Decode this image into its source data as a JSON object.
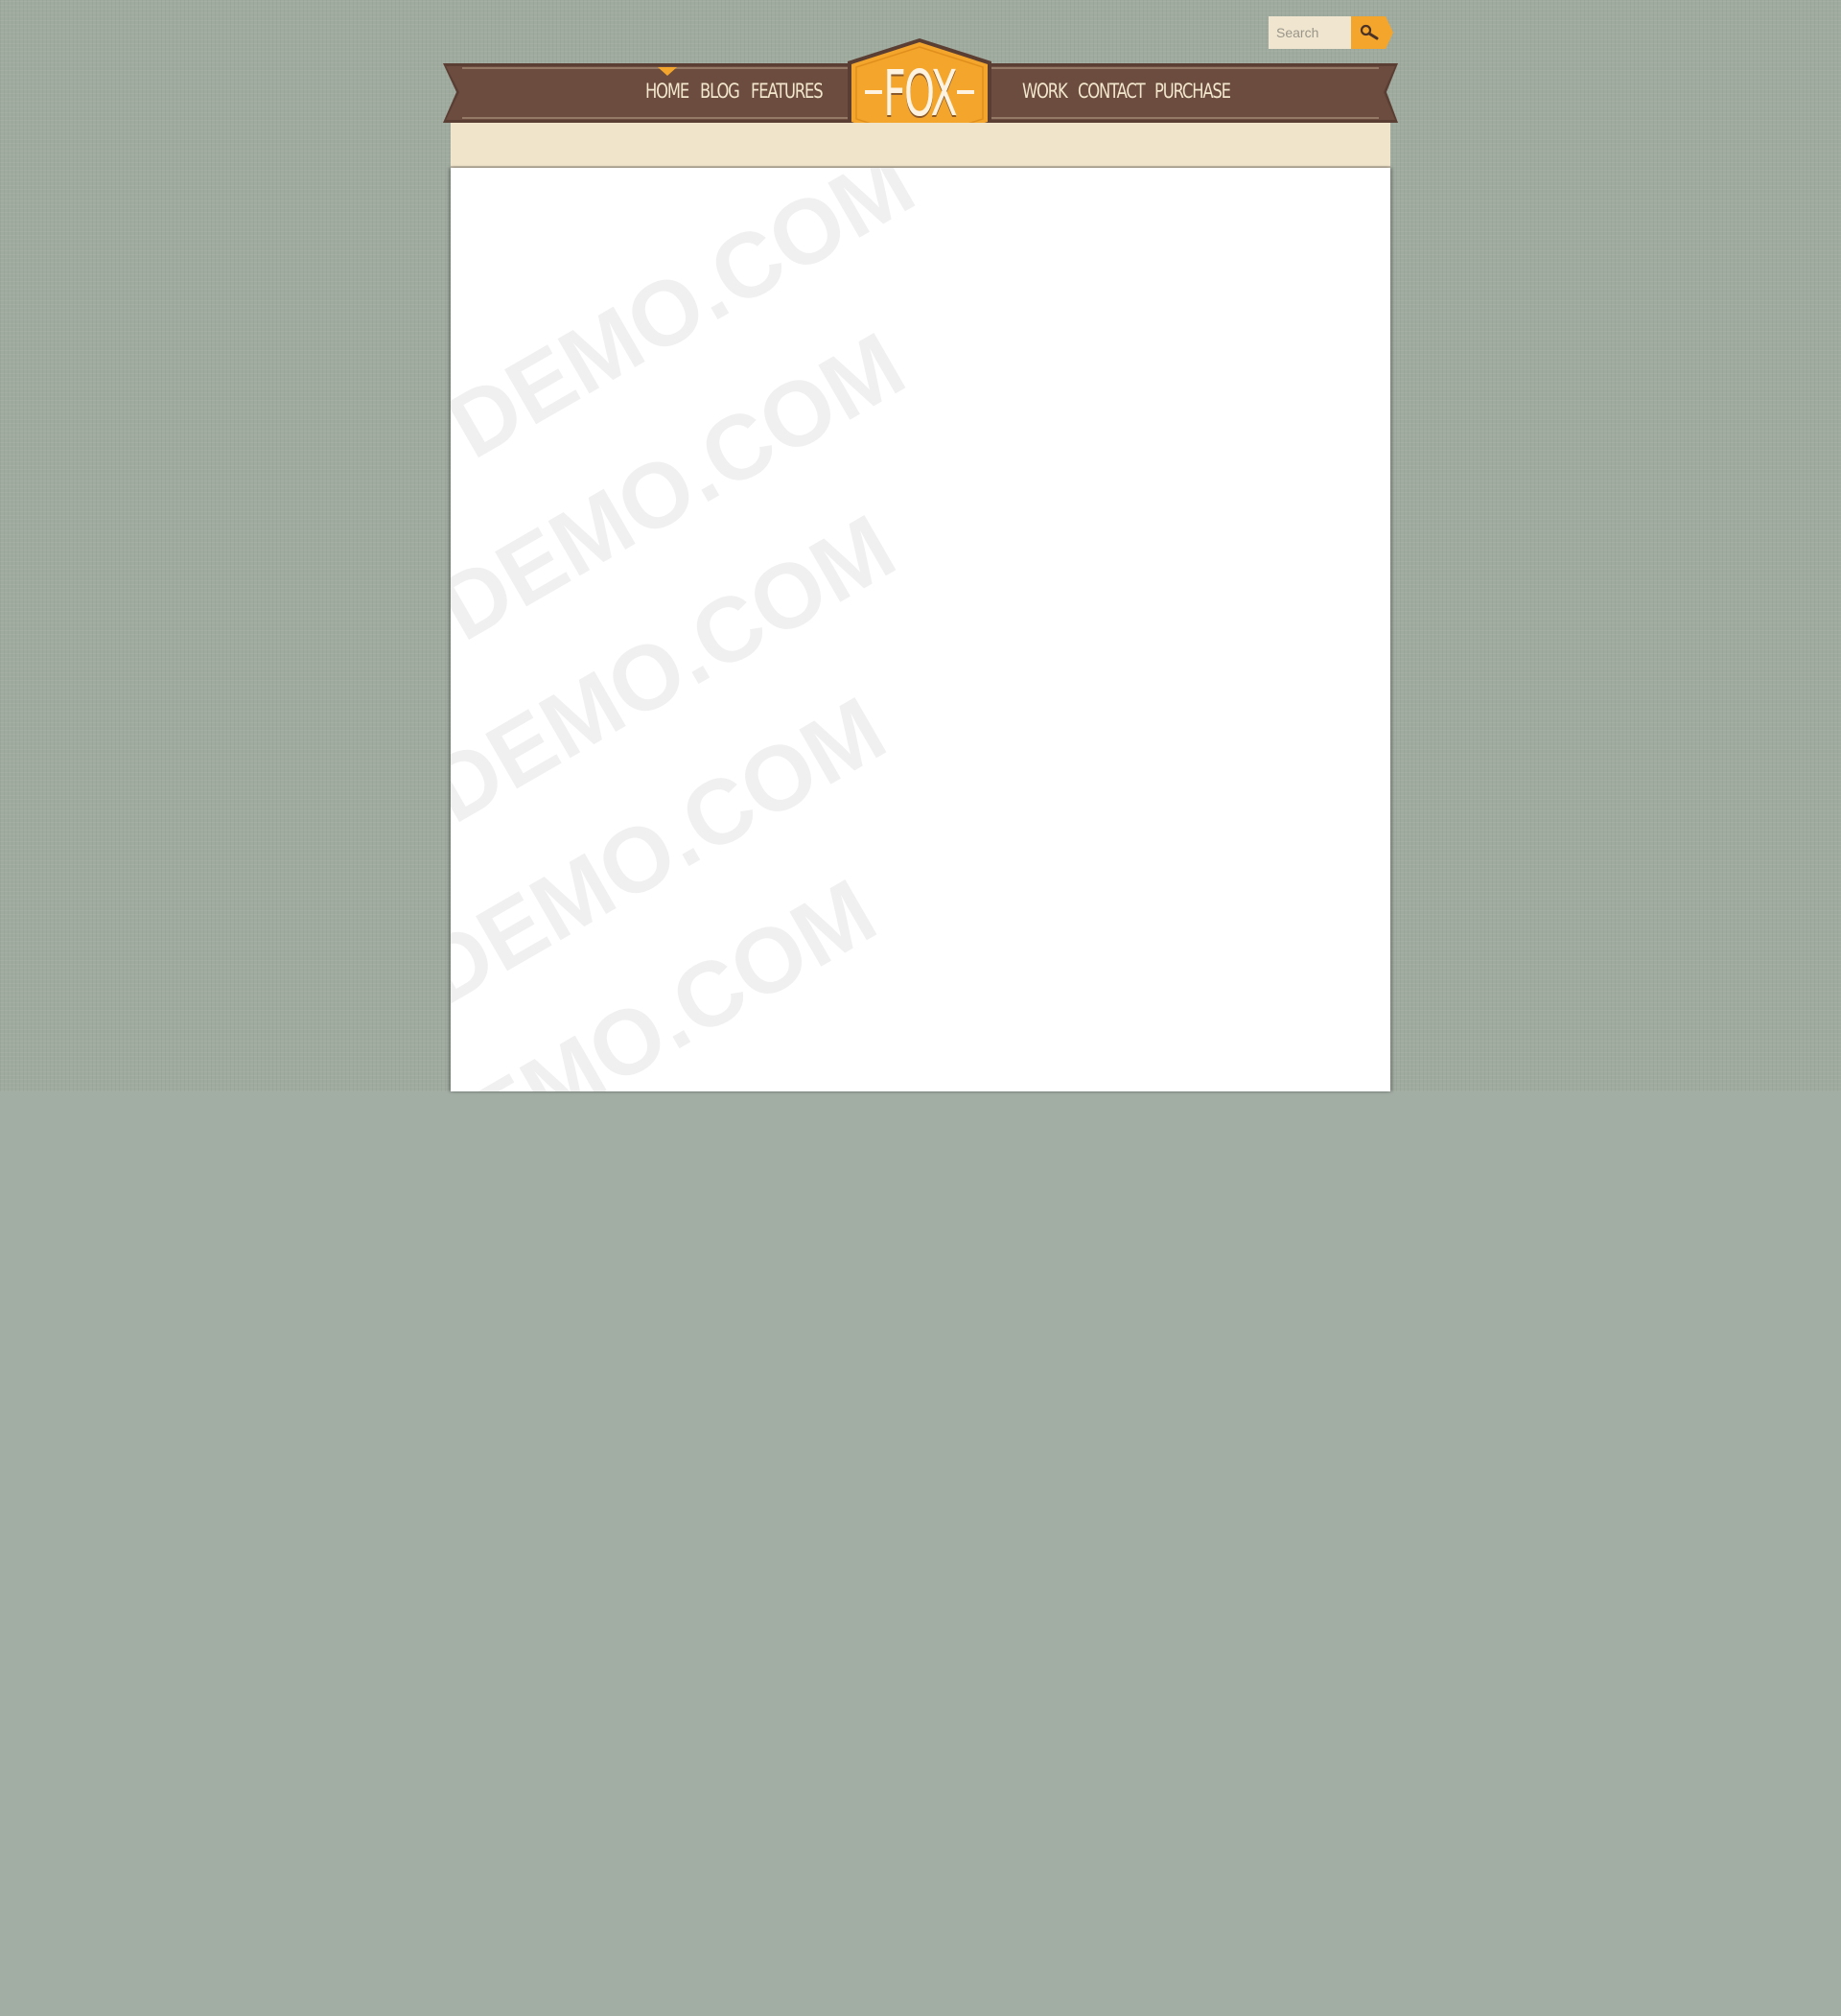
{
  "search": {
    "placeholder": "Search",
    "button_icon": "magnifier-icon"
  },
  "nav": {
    "left_items": [
      {
        "label": "HOME",
        "active": true
      },
      {
        "label": "BLOG",
        "active": false
      },
      {
        "label": "FEATURES",
        "active": false
      }
    ],
    "right_items": [
      {
        "label": "WORK",
        "active": false
      },
      {
        "label": "CONTACT",
        "active": false
      },
      {
        "label": "PURCHASE",
        "active": false
      }
    ]
  },
  "logo": {
    "text": "FOX"
  },
  "watermark": {
    "text": "DEMO.COM"
  },
  "colors": {
    "ribbon": "#6b4c3e",
    "accent": "#f3a52c",
    "cream": "#f0e4cb",
    "background": "#a2ada4"
  }
}
